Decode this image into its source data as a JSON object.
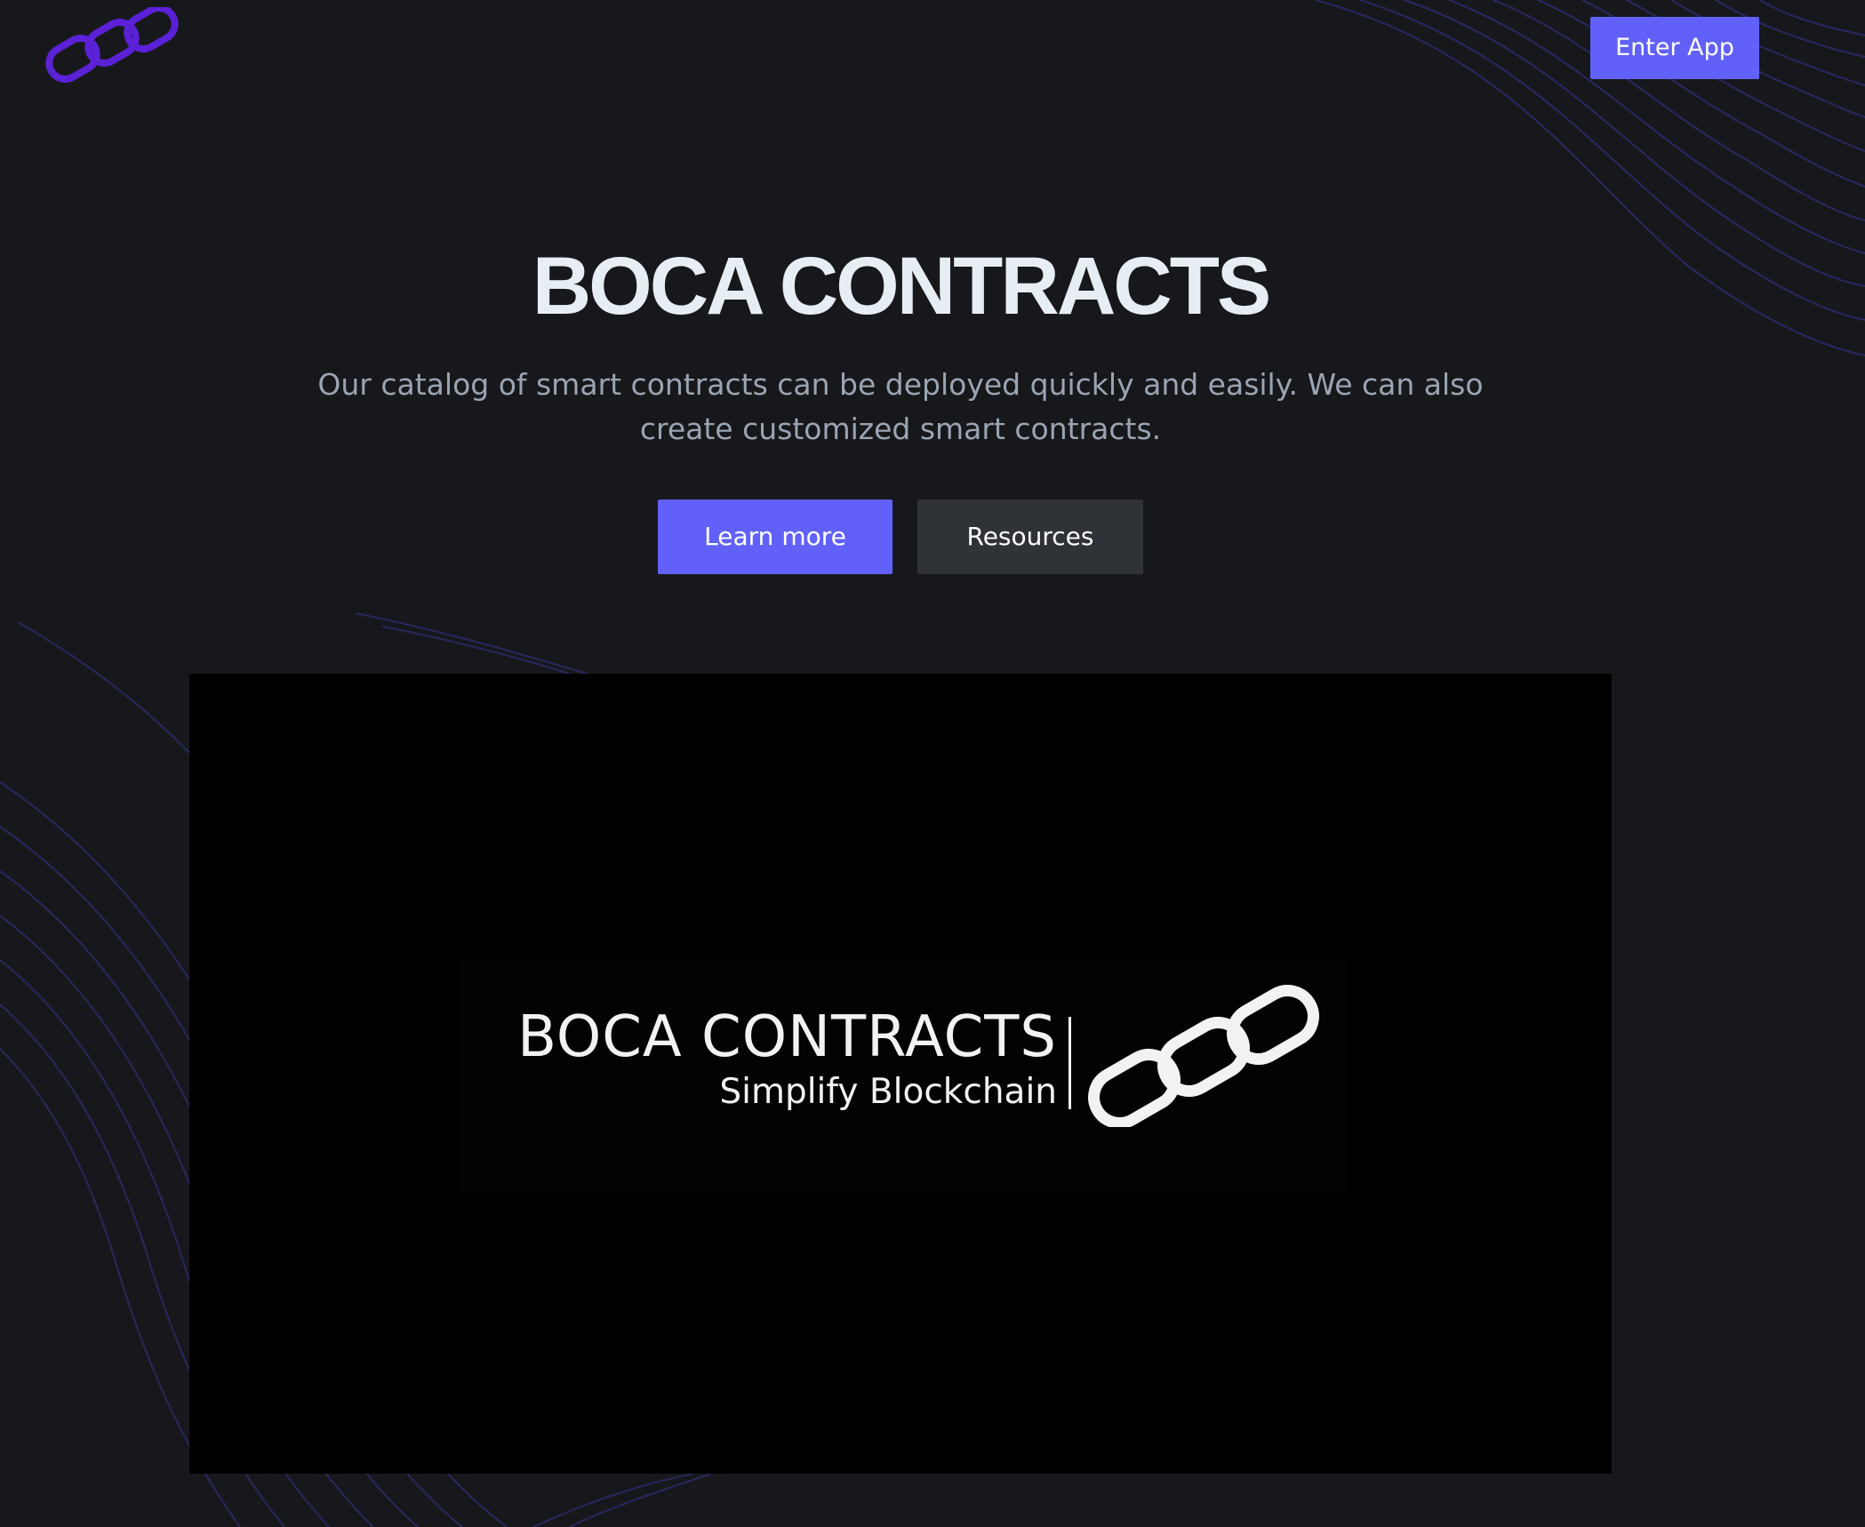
{
  "header": {
    "logo_icon": "chain-link-icon",
    "enter_app_label": "Enter App"
  },
  "hero": {
    "title": "BOCA CONTRACTS",
    "subtitle_line1": "Our catalog of smart contracts can be deployed quickly and easily. We can also",
    "subtitle_line2": "create customized smart contracts.",
    "learn_more_label": "Learn more",
    "resources_label": "Resources"
  },
  "video": {
    "logo_title": "BOCA CONTRACTS",
    "logo_tagline": "Simplify Blockchain",
    "logo_icon": "chain-link-icon"
  },
  "colors": {
    "background": "#17181b",
    "accent": "#6161f9",
    "logo_purple": "#5b21d6",
    "title": "#e6edf3",
    "subtitle": "#9aa4b2",
    "secondary_button": "#2f3237",
    "decorative_lines": "#2b2d6e"
  }
}
